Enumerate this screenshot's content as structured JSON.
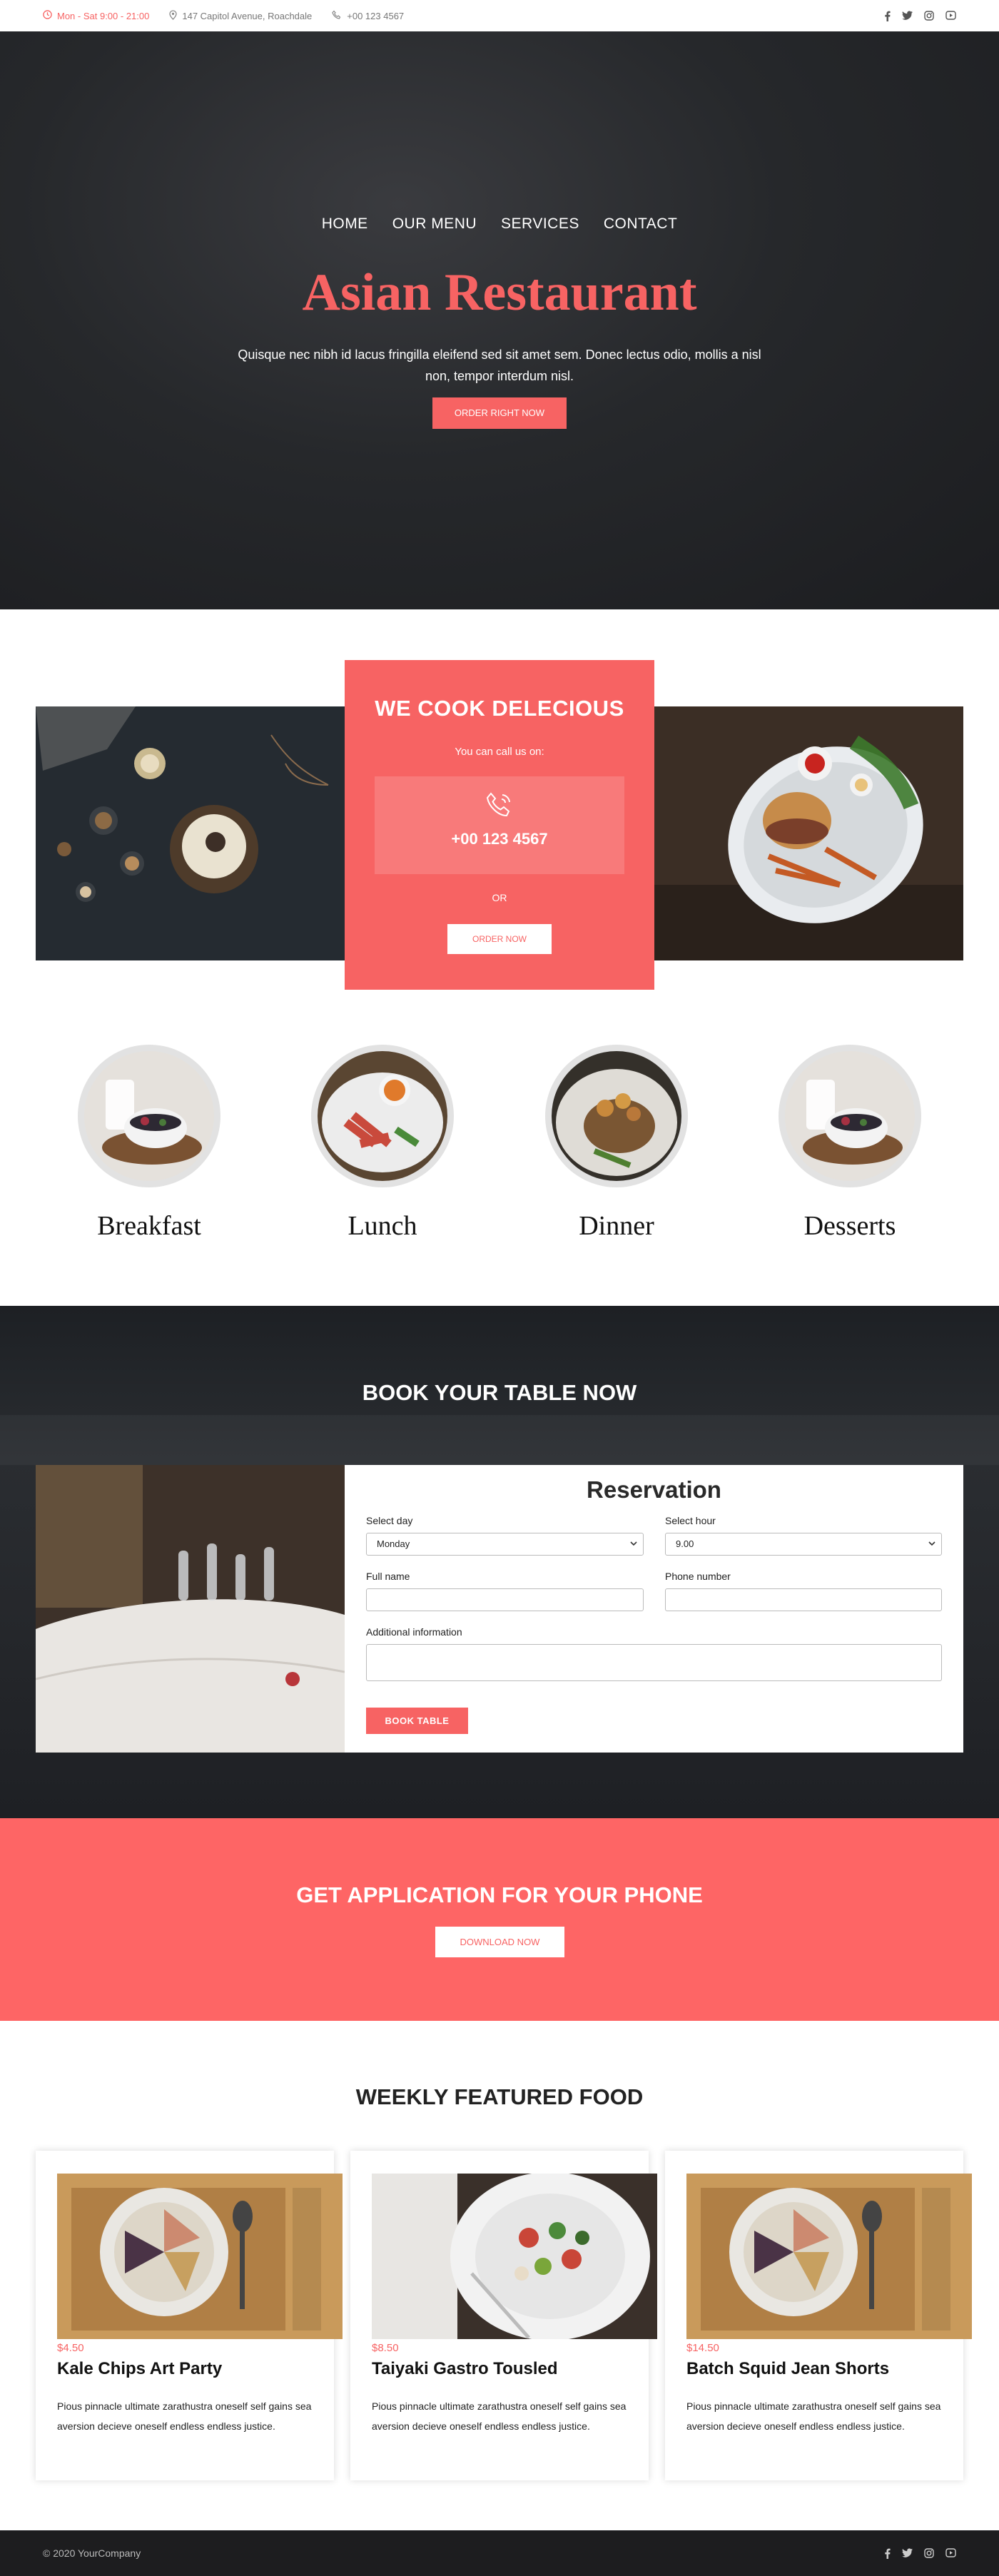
{
  "topbar": {
    "hours": "Mon - Sat 9:00 - 21:00",
    "address": "147 Capitol Avenue, Roachdale",
    "phone": "+00 123 4567"
  },
  "hero": {
    "nav": [
      "HOME",
      "OUR MENU",
      "SERVICES",
      "CONTACT"
    ],
    "title": "Asian Restaurant",
    "text": "Quisque nec nibh id lacus fringilla eleifend sed sit amet sem. Donec lectus odio, mollis a nisl non, tempor interdum nisl.",
    "button": "ORDER RIGHT NOW"
  },
  "call": {
    "title": "WE COOK DELECIOUS",
    "subtitle": "You can call us on:",
    "phone": "+00 123 4567",
    "or": "OR",
    "button": "ORDER NOW"
  },
  "categories": [
    "Breakfast",
    "Lunch",
    "Dinner",
    "Desserts"
  ],
  "booking": {
    "title": "BOOK YOUR TABLE NOW",
    "form_title": "Reservation",
    "select_day_label": "Select day",
    "select_day_value": "Monday",
    "select_hour_label": "Select hour",
    "select_hour_value": "9.00",
    "full_name_label": "Full name",
    "phone_label": "Phone number",
    "info_label": "Additional information",
    "button": "BOOK TABLE"
  },
  "app": {
    "title": "GET APPLICATION FOR YOUR PHONE",
    "button": "DOWNLOAD NOW"
  },
  "featured": {
    "title": "WEEKLY FEATURED FOOD",
    "cards": [
      {
        "price": "$4.50",
        "title": "Kale Chips Art Party",
        "desc": "Pious pinnacle ultimate zarathustra oneself self gains sea aversion decieve oneself endless endless justice."
      },
      {
        "price": "$8.50",
        "title": "Taiyaki Gastro Tousled",
        "desc": "Pious pinnacle ultimate zarathustra oneself self gains sea aversion decieve oneself endless endless justice."
      },
      {
        "price": "$14.50",
        "title": "Batch Squid Jean Shorts",
        "desc": "Pious pinnacle ultimate zarathustra oneself self gains sea aversion decieve oneself endless endless justice."
      }
    ]
  },
  "footer": {
    "copyright": "© 2020 YourCompany"
  },
  "icons": {
    "clock": "clock-icon",
    "location": "map-pin-icon",
    "phone": "phone-icon",
    "social": [
      "facebook-icon",
      "twitter-icon",
      "instagram-icon",
      "youtube-icon"
    ]
  },
  "colors": {
    "accent": "#f76363",
    "dark": "#1d1d1f"
  }
}
